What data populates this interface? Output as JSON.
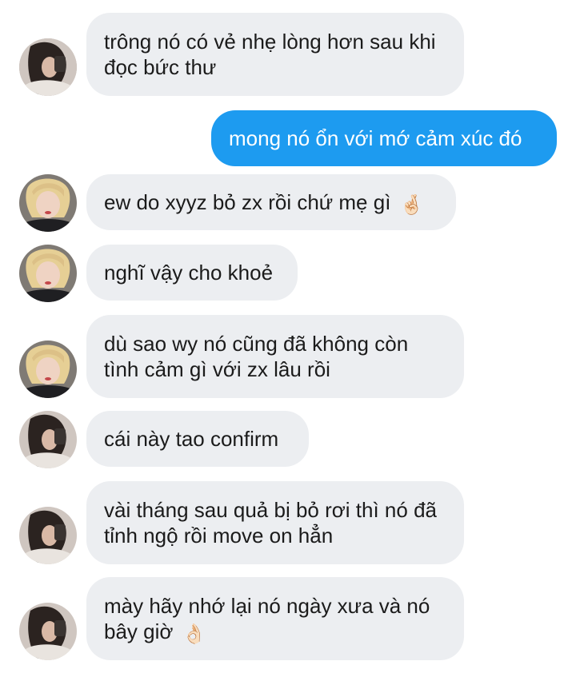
{
  "conversation": {
    "messages": [
      {
        "side": "incoming",
        "avatar": "avatar-dark-hair",
        "text": "trông nó có vẻ nhẹ lòng hơn sau khi đọc bức thư",
        "emoji": ""
      },
      {
        "side": "outgoing",
        "avatar": "",
        "text": "mong nó ổn với mớ cảm xúc đó",
        "emoji": ""
      },
      {
        "side": "incoming",
        "avatar": "avatar-blonde",
        "text": "ew do xyyz bỏ zx rồi chứ mẹ gì",
        "emoji": "🤞🏻"
      },
      {
        "side": "incoming",
        "avatar": "avatar-blonde",
        "text": "nghĩ vậy cho khoẻ",
        "emoji": ""
      },
      {
        "side": "incoming",
        "avatar": "avatar-blonde",
        "text": "dù sao wy nó cũng đã không còn tình cảm gì với zx lâu rồi",
        "emoji": ""
      },
      {
        "side": "incoming",
        "avatar": "avatar-dark-hair",
        "text": "cái này tao confirm",
        "emoji": ""
      },
      {
        "side": "incoming",
        "avatar": "avatar-dark-hair",
        "text": "vài tháng sau quả bị bỏ rơi thì nó đã tỉnh ngộ rồi move on hẳn",
        "emoji": ""
      },
      {
        "side": "incoming",
        "avatar": "avatar-dark-hair",
        "text": "mày hãy nhớ lại nó ngày xưa và nó bây giờ",
        "emoji": "👌🏻"
      }
    ]
  },
  "colors": {
    "incoming_bubble": "#eceef1",
    "outgoing_bubble": "#1d9bf0",
    "incoming_text": "#1b1b1b",
    "outgoing_text": "#ffffff"
  }
}
